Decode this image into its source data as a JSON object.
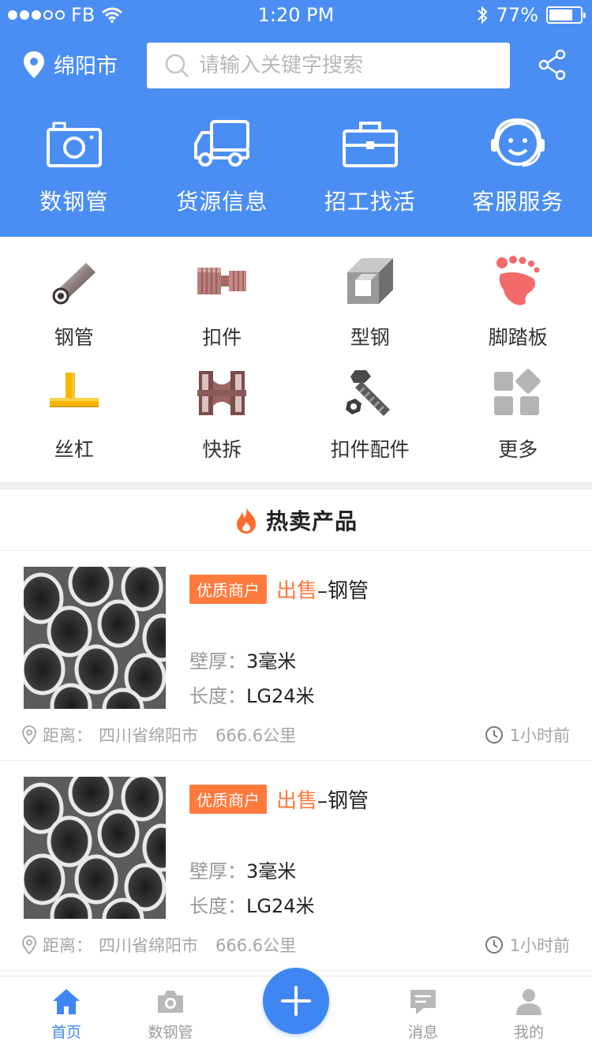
{
  "status_bar": {
    "carrier": "FB",
    "time": "1:20 PM",
    "battery": "77%",
    "battery_level": 0.77
  },
  "header": {
    "city": "绵阳市",
    "search_placeholder": "请输入关键字搜索"
  },
  "quick_nav": [
    {
      "label": "数钢管",
      "icon": "camera-icon"
    },
    {
      "label": "货源信息",
      "icon": "truck-icon"
    },
    {
      "label": "招工找活",
      "icon": "toolbox-icon"
    },
    {
      "label": "客服服务",
      "icon": "support-headset-icon"
    }
  ],
  "categories": [
    {
      "label": "钢管",
      "icon": "steel-pipe-icon"
    },
    {
      "label": "扣件",
      "icon": "clamp-icon"
    },
    {
      "label": "型钢",
      "icon": "section-steel-icon"
    },
    {
      "label": "脚踏板",
      "icon": "footprint-icon"
    },
    {
      "label": "丝杠",
      "icon": "screw-jack-icon"
    },
    {
      "label": "快拆",
      "icon": "quick-release-icon"
    },
    {
      "label": "扣件配件",
      "icon": "bolt-nut-icon"
    },
    {
      "label": "更多",
      "icon": "more-grid-icon"
    }
  ],
  "section": {
    "title": "热卖产品"
  },
  "products": [
    {
      "badge": "优质商户",
      "sale": "出售",
      "dash": "–",
      "name": "钢管",
      "thickness_label": "壁厚：",
      "thickness": "3毫米",
      "length_label": "长度：",
      "length": "LG24米",
      "distance_label": "距离：",
      "location": "四川省绵阳市",
      "distance": "666.6公里",
      "time": "1小时前"
    },
    {
      "badge": "优质商户",
      "sale": "出售",
      "dash": "–",
      "name": "钢管",
      "thickness_label": "壁厚：",
      "thickness": "3毫米",
      "length_label": "长度：",
      "length": "LG24米",
      "distance_label": "距离：",
      "location": "四川省绵阳市",
      "distance": "666.6公里",
      "time": "1小时前"
    }
  ],
  "tabbar": {
    "home": "首页",
    "count_pipes": "数钢管",
    "messages": "消息",
    "mine": "我的"
  },
  "colors": {
    "primary": "#4b8ef3",
    "accent": "#ff7a3d",
    "tab_active": "#3f86f2"
  }
}
